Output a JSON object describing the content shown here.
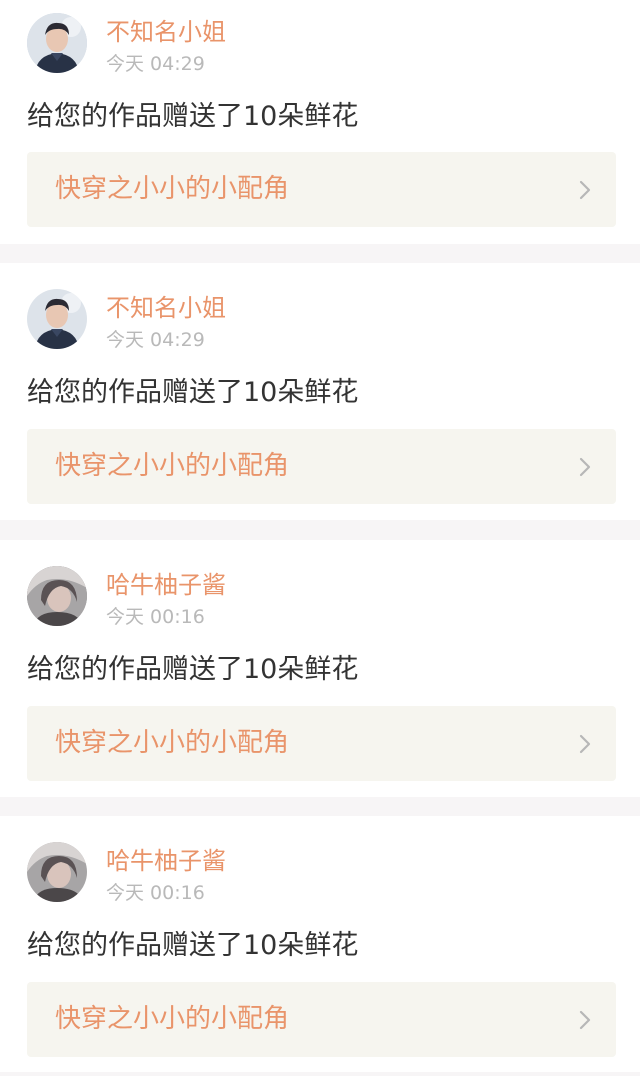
{
  "notifications": [
    {
      "username": "不知名小姐",
      "time": "今天 04:29",
      "message": "给您的作品赠送了10朵鲜花",
      "work_title": "快穿之小小的小配角",
      "avatar": "avatar-male-photo"
    },
    {
      "username": "不知名小姐",
      "time": "今天 04:29",
      "message": "给您的作品赠送了10朵鲜花",
      "work_title": "快穿之小小的小配角",
      "avatar": "avatar-male-photo"
    },
    {
      "username": "哈牛柚子酱",
      "time": "今天 00:16",
      "message": "给您的作品赠送了10朵鲜花",
      "work_title": "快穿之小小的小配角",
      "avatar": "avatar-female-photo"
    },
    {
      "username": "哈牛柚子酱",
      "time": "今天 00:16",
      "message": "给您的作品赠送了10朵鲜花",
      "work_title": "快穿之小小的小配角",
      "avatar": "avatar-female-photo"
    }
  ],
  "colors": {
    "accent": "#e9946a",
    "timestamp": "#b9b9b9",
    "message": "#333333",
    "link_background": "#f6f5ef",
    "page_background": "#f7f5f6"
  },
  "icons": {
    "chevron": "chevron-right-icon"
  }
}
